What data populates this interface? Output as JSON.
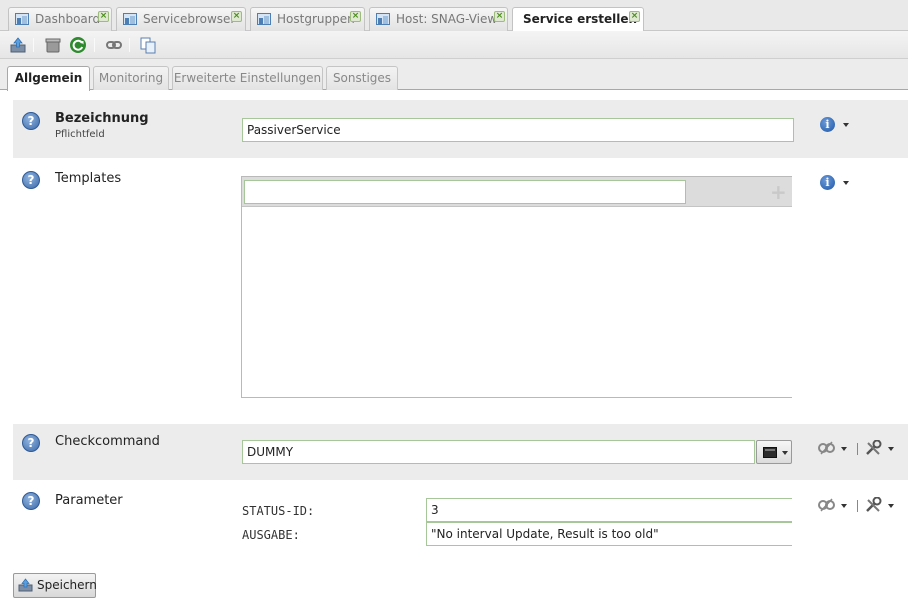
{
  "top_tabs": [
    {
      "label": "Dashboard",
      "active": false,
      "icon": "dashboard-icon"
    },
    {
      "label": "Servicebrowser",
      "active": false,
      "icon": "grid-icon"
    },
    {
      "label": "Hostgruppen",
      "active": false,
      "icon": "grid-icon"
    },
    {
      "label": "Host: SNAG-View",
      "active": false,
      "icon": "grid-icon"
    },
    {
      "label": "Service erstellen",
      "active": true,
      "icon": null
    }
  ],
  "toolbar": {
    "buttons": [
      "upload-icon",
      "delete-icon",
      "refresh-icon",
      "link-icon",
      "copy-icon"
    ]
  },
  "form_tabs": [
    {
      "label": "Allgemein",
      "active": true
    },
    {
      "label": "Monitoring",
      "active": false
    },
    {
      "label": "Erweiterte Einstellungen",
      "active": false
    },
    {
      "label": "Sonstiges",
      "active": false
    }
  ],
  "fields": {
    "bezeichnung": {
      "label": "Bezeichnung",
      "sublabel": "Pflichtfeld",
      "value": "PassiverService"
    },
    "templates": {
      "label": "Templates",
      "value": ""
    },
    "checkcommand": {
      "label": "Checkcommand",
      "value": "DUMMY"
    },
    "parameter": {
      "label": "Parameter",
      "params": [
        {
          "name": "STATUS-ID:",
          "value": "3"
        },
        {
          "name": "AUSGABE:",
          "value": "\"No interval Update, Result is too old\""
        }
      ]
    }
  },
  "save_button": {
    "label": "Speichern"
  },
  "colors": {
    "shaded_row": "#ececec",
    "input_border": "#a7c79a",
    "help_blue": "#3c6aa8"
  }
}
